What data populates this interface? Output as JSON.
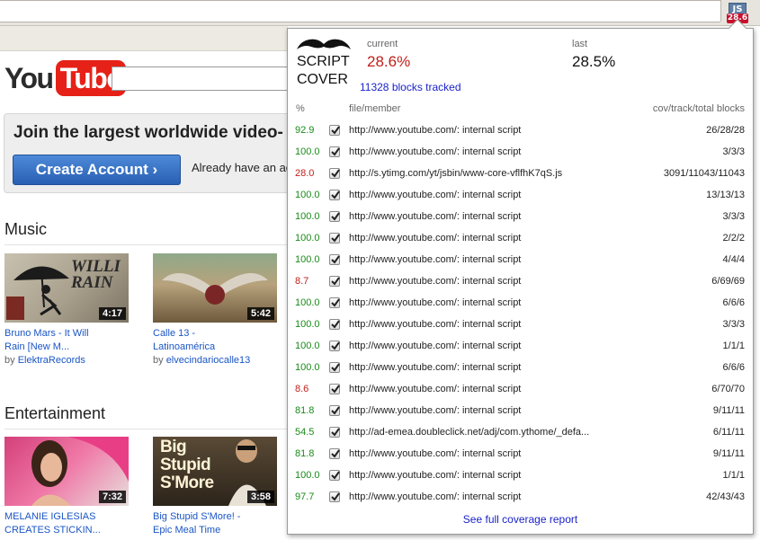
{
  "extension": {
    "icon_label": "JS",
    "badge": "28.6",
    "icon": "scriptcover-extension-icon"
  },
  "youtube": {
    "logo_you": "You",
    "logo_tube": "Tube",
    "join_title": "Join the largest worldwide video-",
    "create_account": "Create Account ›",
    "already_text": "Already have an ac",
    "sections": [
      {
        "title": "Music",
        "videos": [
          {
            "title": "Bruno Mars - It Will\nRain [New M...",
            "by_prefix": "by",
            "channel": "ElektraRecords",
            "duration": "4:17"
          },
          {
            "title": "Calle 13 -\nLatinoamérica",
            "by_prefix": "by",
            "channel": "elvecindariocalle13",
            "duration": "5:42"
          }
        ]
      },
      {
        "title": "Entertainment",
        "videos": [
          {
            "title": "MELANIE IGLESIAS\nCREATES STICKIN...",
            "by_prefix": "",
            "channel": "",
            "duration": "7:32"
          },
          {
            "title": "Big Stupid S'More! -\nEpic Meal Time",
            "by_prefix": "",
            "channel": "",
            "duration": "3:58"
          }
        ]
      }
    ],
    "thumb_art": {
      "willi": "WILLI RAIN",
      "big": "Big\nStupid\nS'More"
    }
  },
  "popup": {
    "logo_line1": "SCRIPT",
    "logo_line2": "COVER",
    "current_label": "current",
    "current_value": "28.6%",
    "last_label": "last",
    "last_value": "28.5%",
    "blocks_tracked": "11328 blocks tracked",
    "headers": {
      "pct": "%",
      "file": "file/member",
      "cov": "cov/track/total blocks"
    },
    "colors": {
      "high": "#1a8a1a",
      "low": "#c0201a",
      "link": "#1a22c9"
    },
    "rows": [
      {
        "pct": "92.9",
        "level": "high",
        "file": "http://www.youtube.com/: internal script",
        "cov": "26/28/28"
      },
      {
        "pct": "100.0",
        "level": "high",
        "file": "http://www.youtube.com/: internal script",
        "cov": "3/3/3"
      },
      {
        "pct": "28.0",
        "level": "low",
        "file": "http://s.ytimg.com/yt/jsbin/www-core-vflfhK7qS.js",
        "cov": "3091/11043/11043"
      },
      {
        "pct": "100.0",
        "level": "high",
        "file": "http://www.youtube.com/: internal script",
        "cov": "13/13/13"
      },
      {
        "pct": "100.0",
        "level": "high",
        "file": "http://www.youtube.com/: internal script",
        "cov": "3/3/3"
      },
      {
        "pct": "100.0",
        "level": "high",
        "file": "http://www.youtube.com/: internal script",
        "cov": "2/2/2"
      },
      {
        "pct": "100.0",
        "level": "high",
        "file": "http://www.youtube.com/: internal script",
        "cov": "4/4/4"
      },
      {
        "pct": "8.7",
        "level": "low",
        "file": "http://www.youtube.com/: internal script",
        "cov": "6/69/69"
      },
      {
        "pct": "100.0",
        "level": "high",
        "file": "http://www.youtube.com/: internal script",
        "cov": "6/6/6"
      },
      {
        "pct": "100.0",
        "level": "high",
        "file": "http://www.youtube.com/: internal script",
        "cov": "3/3/3"
      },
      {
        "pct": "100.0",
        "level": "high",
        "file": "http://www.youtube.com/: internal script",
        "cov": "1/1/1"
      },
      {
        "pct": "100.0",
        "level": "high",
        "file": "http://www.youtube.com/: internal script",
        "cov": "6/6/6"
      },
      {
        "pct": "8.6",
        "level": "low",
        "file": "http://www.youtube.com/: internal script",
        "cov": "6/70/70"
      },
      {
        "pct": "81.8",
        "level": "high",
        "file": "http://www.youtube.com/: internal script",
        "cov": "9/11/11"
      },
      {
        "pct": "54.5",
        "level": "high",
        "file": "http://ad-emea.doubleclick.net/adj/com.ythome/_defa...",
        "cov": "6/11/11"
      },
      {
        "pct": "81.8",
        "level": "high",
        "file": "http://www.youtube.com/: internal script",
        "cov": "9/11/11"
      },
      {
        "pct": "100.0",
        "level": "high",
        "file": "http://www.youtube.com/: internal script",
        "cov": "1/1/1"
      },
      {
        "pct": "97.7",
        "level": "high",
        "file": "http://www.youtube.com/: internal script",
        "cov": "42/43/43"
      }
    ],
    "full_report": "See full coverage report"
  }
}
